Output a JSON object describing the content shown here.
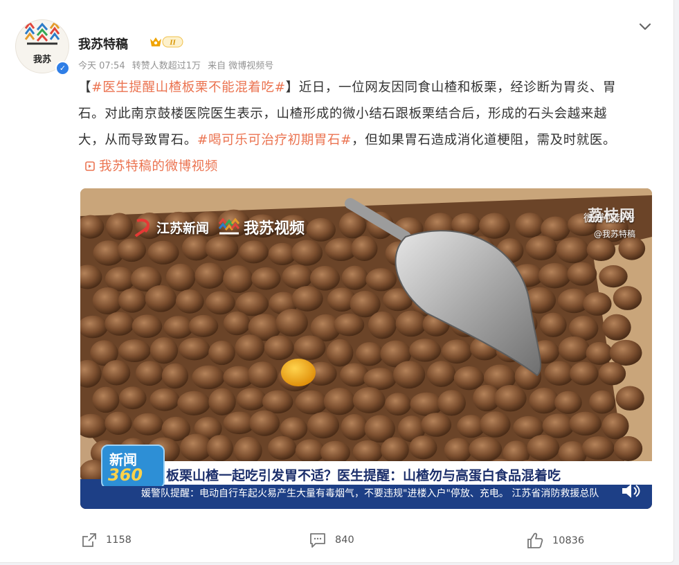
{
  "author": {
    "name": "我苏特稿",
    "avatar_text": "我苏",
    "badge_text": "II",
    "verified": true
  },
  "meta": {
    "time": "今天 07:54",
    "reposts_note": "转赞人数超过1万",
    "source": "来自 微博视频号"
  },
  "post": {
    "bracket_open": "【",
    "tag1": "#医生提醒山楂板栗不能混着吃#",
    "bracket_close": "】",
    "text1": "近日，一位网友因同食山楂和板栗，经诊断为胃炎、胃石。对此南京鼓楼医院医生表示，山楂形成的微小结石跟板栗结合后，形成的石头会越来越大，从而导致胃石。",
    "tag2": "#喝可乐可治疗初期胃石#",
    "text2": "，但如果胃石造成消化道梗阻，需及时就医。",
    "video_link": "我苏特稿的微博视频"
  },
  "video": {
    "watermark_left_1": "江苏新闻",
    "watermark_left_2": "我苏视频",
    "watermark_right_big": "荔枝网",
    "watermark_right_mid": "微博视频号",
    "watermark_right_small": "@我苏特稿",
    "news_logo_1": "新闻",
    "news_logo_2": "360",
    "headline": "板栗山楂一起吃引发胃不适？医生提醒：山楂勿与高蛋白食品混着吃",
    "ticker": "媛警队提醒：电动自行车起火易产生大量有毒烟气，不要违规\"进楼入户\"停放、充电。    江苏省消防救援总队"
  },
  "actions": {
    "repost_count": "1158",
    "comment_count": "840",
    "like_count": "10836"
  },
  "colors": {
    "accent": "#eb7350",
    "verified": "#2f7ee6"
  },
  "icons": [
    "chevron-down-icon",
    "verified-icon",
    "video-link-icon",
    "volume-icon",
    "repost-icon",
    "comment-icon",
    "like-icon"
  ]
}
